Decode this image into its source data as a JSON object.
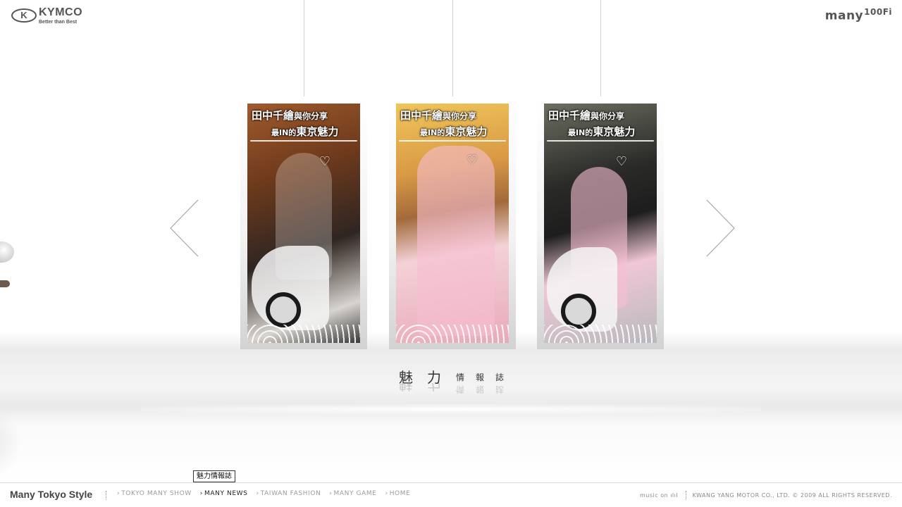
{
  "header": {
    "logo_mark": "K",
    "logo_name": "KYMCO",
    "logo_tagline": "Better than Best",
    "brand_name": "many",
    "brand_model": "100Fi"
  },
  "gallery": {
    "items": [
      {
        "title_line1": "田中千繪",
        "title_line1_small": "與你分享",
        "title_line2_small": "最IN的",
        "title_line2": "東京魅力",
        "heart": "♡"
      },
      {
        "title_line1": "田中千繪",
        "title_line1_small": "與你分享",
        "title_line2_small": "最IN的",
        "title_line2": "東京魅力",
        "heart": "♡"
      },
      {
        "title_line1": "田中千繪",
        "title_line1_small": "與你分享",
        "title_line2_small": "最IN的",
        "title_line2": "東京魅力",
        "heart": "♡"
      }
    ]
  },
  "caption": {
    "big1": "魅",
    "big2": "力",
    "small1": "情",
    "small2": "報",
    "small3": "誌"
  },
  "footer": {
    "title": "Many Tokyo Style",
    "nav": [
      {
        "label": "TOKYO MANY SHOW",
        "active": false
      },
      {
        "label": "MANY NEWS",
        "active": true
      },
      {
        "label": "TAIWAN FASHION",
        "active": false
      },
      {
        "label": "MANY GAME",
        "active": false
      },
      {
        "label": "HOME",
        "active": false
      }
    ],
    "chevron": "›",
    "tooltip": "魅力情報誌",
    "music": "music on ılıl",
    "copyright": "KWANG YANG MOTOR CO., LTD. © 2009 ALL RIGHTS RESERVED."
  }
}
